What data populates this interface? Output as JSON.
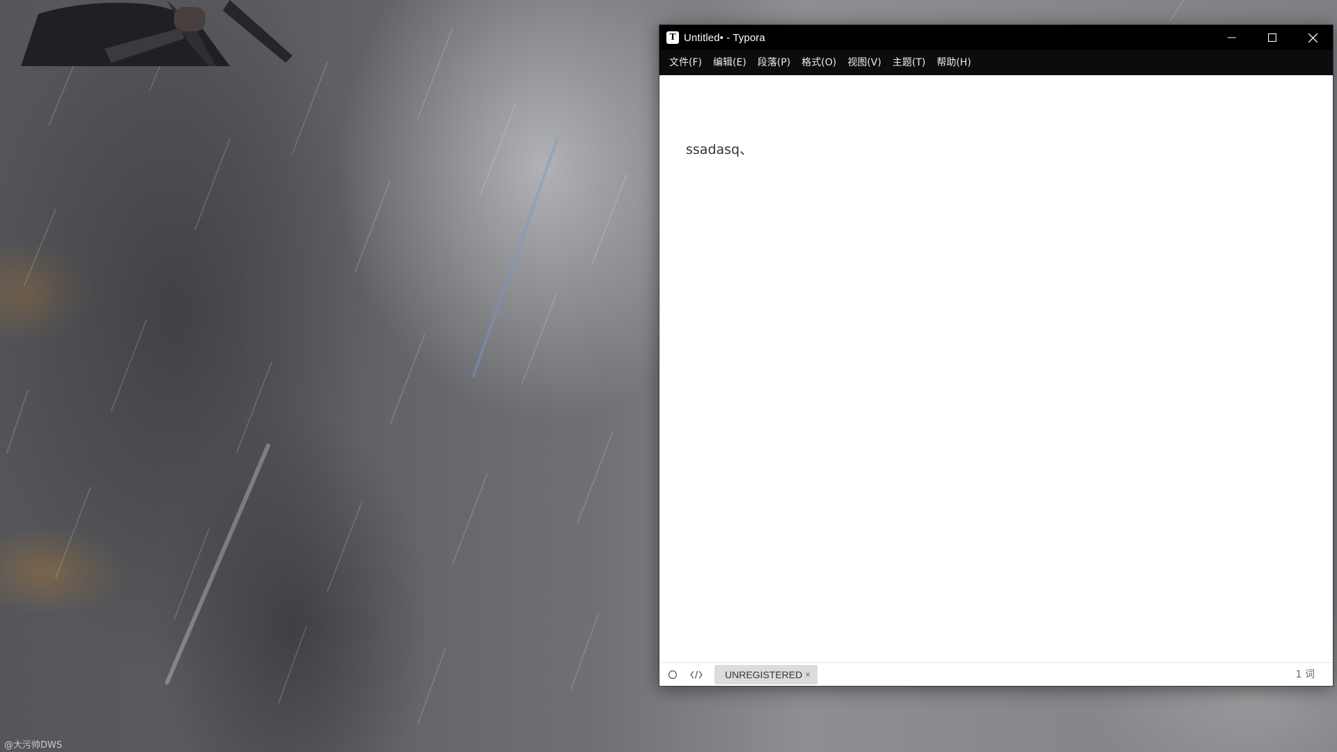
{
  "desktop": {
    "watermark": "@大污帅DWS"
  },
  "window": {
    "app_icon_letter": "T",
    "title": "Untitled• - Typora",
    "controls": {
      "minimize": "minimize-icon",
      "maximize": "maximize-icon",
      "close": "close-icon"
    }
  },
  "menubar": {
    "items": [
      {
        "label": "文件(F)"
      },
      {
        "label": "编辑(E)"
      },
      {
        "label": "段落(P)"
      },
      {
        "label": "格式(O)"
      },
      {
        "label": "视图(V)"
      },
      {
        "label": "主题(T)"
      },
      {
        "label": "帮助(H)"
      }
    ]
  },
  "editor": {
    "content": "ssadasq、"
  },
  "statusbar": {
    "outline_icon": "circle-icon",
    "source_icon": "code-icon",
    "unregistered_label": "UNREGISTERED",
    "unregistered_close": "×",
    "word_count": "1 词"
  },
  "colors": {
    "titlebar_bg": "#000000",
    "menubar_bg": "#0c0c0c",
    "editor_bg": "#ffffff",
    "badge_bg": "#dcdcdc"
  }
}
